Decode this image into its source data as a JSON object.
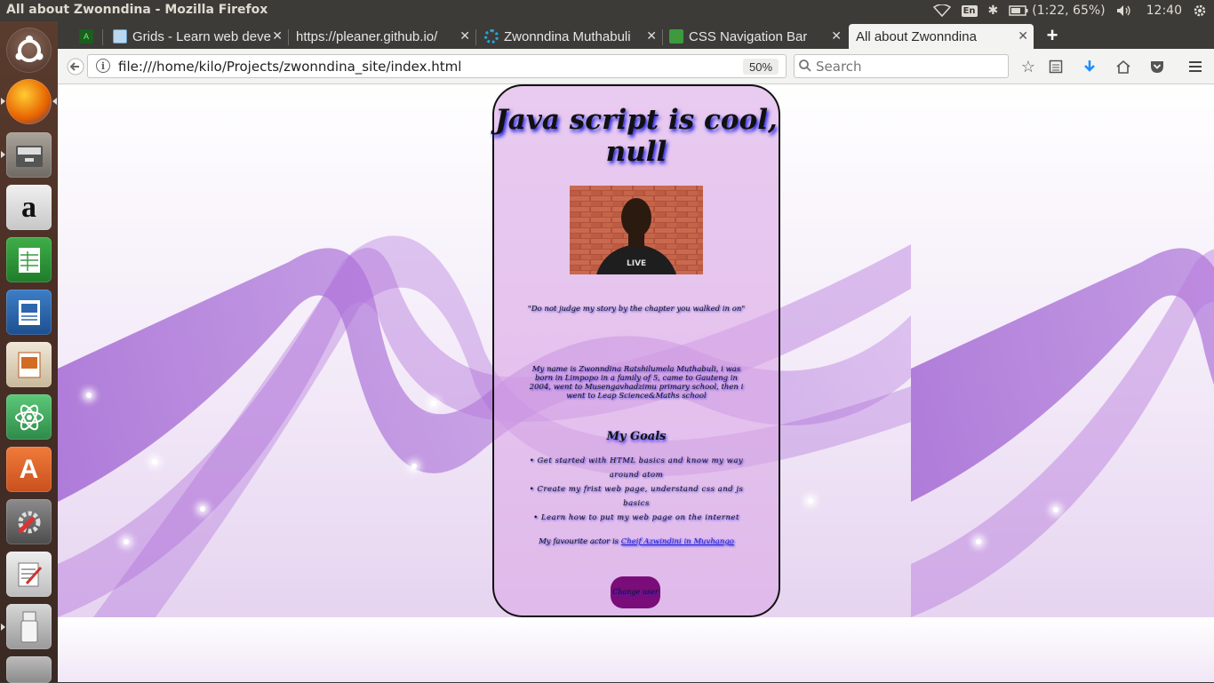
{
  "system": {
    "window_title": "All about Zwonndina - Mozilla Firefox",
    "lang": "En",
    "battery": "(1:22, 65%)",
    "clock": "12:40"
  },
  "launcher": {
    "items": [
      "ubuntu-dash",
      "firefox",
      "files",
      "amazon",
      "libreoffice-calc",
      "libreoffice-impress-draw",
      "libreoffice-impress",
      "atom",
      "software-center",
      "system-settings",
      "text-editor",
      "usb-drive",
      "trash"
    ]
  },
  "tabs": [
    {
      "label": "",
      "icon": "android-icon"
    },
    {
      "label": "Grids - Learn web deve",
      "icon": "mdn-icon"
    },
    {
      "label": "https://pleaner.github.io/",
      "icon": ""
    },
    {
      "label": "Zwonndina Muthabuli",
      "icon": "spinner-icon"
    },
    {
      "label": "CSS Navigation Bar",
      "icon": "codepen-icon"
    },
    {
      "label": "All about Zwonndina",
      "icon": ""
    }
  ],
  "nav": {
    "url": "file:///home/kilo/Projects/zwonndina_site/index.html",
    "zoom": "50%",
    "search_placeholder": "Search"
  },
  "page": {
    "heading": "Java script is cool, null",
    "quote": "\"Do not judge my story by the chapter you walked in on\"",
    "bio": "My name is Zwonndina Ratshilumela Muthabuli, i was born in Limpopo in a family of 5, came to Gauteng in 2004, went to Musengavhadzimu primary school, then i went to Leap Science&Maths school",
    "goals_title": "My Goals",
    "goals": [
      "Get started with HTML basics and know my way around atom",
      "Create my frist web page, understand css and js basics",
      "Learn how to put my web page on the internet"
    ],
    "actor_prefix": "My favourite actor is ",
    "actor_link": "Cheif Azwindini in Muvhango",
    "button_label": "Change user"
  },
  "colors": {
    "card_bg": "#dcaae6",
    "button_bg": "#7a0d7a",
    "text_shadow": "#1c1ce0",
    "active_tab": "#f3f3f1",
    "chrome_dark": "#3c3b37"
  }
}
